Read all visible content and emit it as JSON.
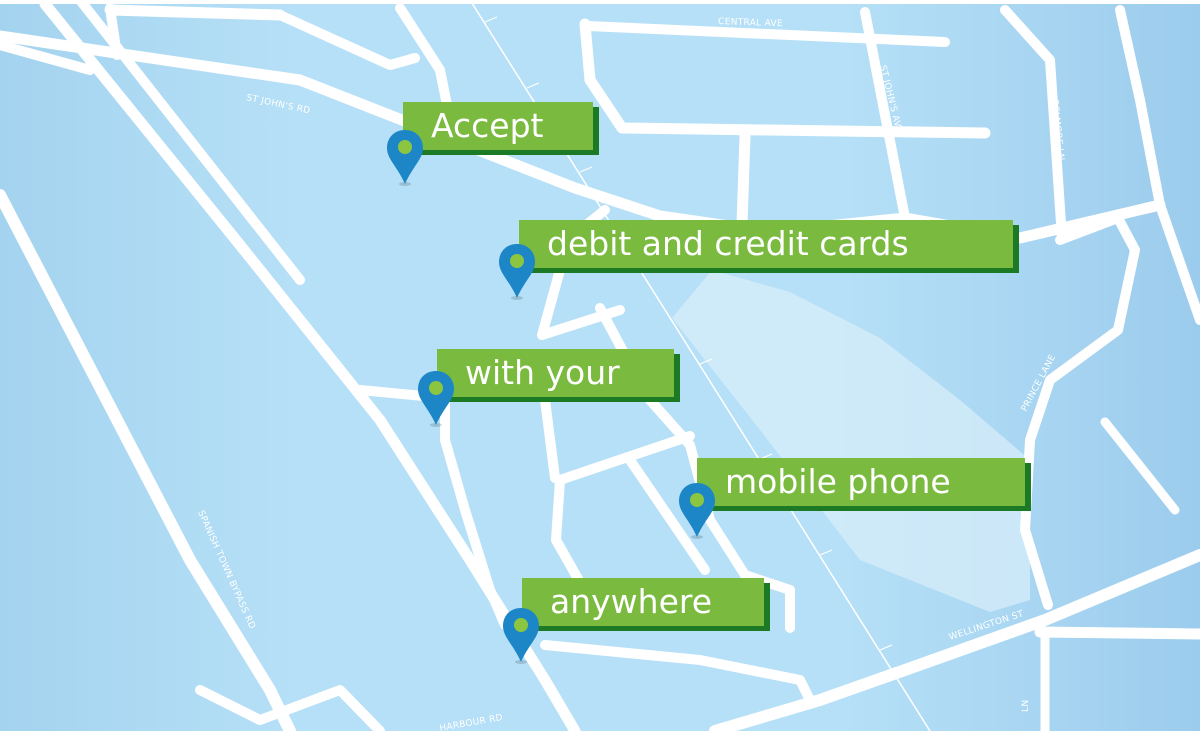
{
  "map": {
    "streets": [
      {
        "id": "central-ave",
        "name": "CENTRAL AVE"
      },
      {
        "id": "st-johns-rd",
        "name": "ST JOHN'S RD"
      },
      {
        "id": "st-johns-ave",
        "name": "ST JOHN'S AVE"
      },
      {
        "id": "belmore-ln",
        "name": "BELMORE LN"
      },
      {
        "id": "prince-lane",
        "name": "PRINCE LANE"
      },
      {
        "id": "spanish-town-bypass-rd",
        "name": "SPANISH TOWN BYPASS RD"
      },
      {
        "id": "wellington-st",
        "name": "WELLINGTON ST"
      },
      {
        "id": "harbour-rd",
        "name": "HARBOUR RD"
      },
      {
        "id": "ln",
        "name": "LN"
      }
    ]
  },
  "banners": [
    {
      "id": "accept",
      "text": "Accept"
    },
    {
      "id": "cards",
      "text": "debit and credit cards"
    },
    {
      "id": "with-your",
      "text": "with your"
    },
    {
      "id": "mobile-phone",
      "text": "mobile phone"
    },
    {
      "id": "anywhere",
      "text": "anywhere"
    }
  ],
  "colors": {
    "map_water": "#b3ddf5",
    "roads": "#ffffff",
    "banner_green": "#79ba3f",
    "banner_shadow": "#1c7a25",
    "pin_blue": "#1d86c6",
    "pin_dot": "#8cc641"
  },
  "icons": {
    "pin": "map-pin-icon"
  }
}
